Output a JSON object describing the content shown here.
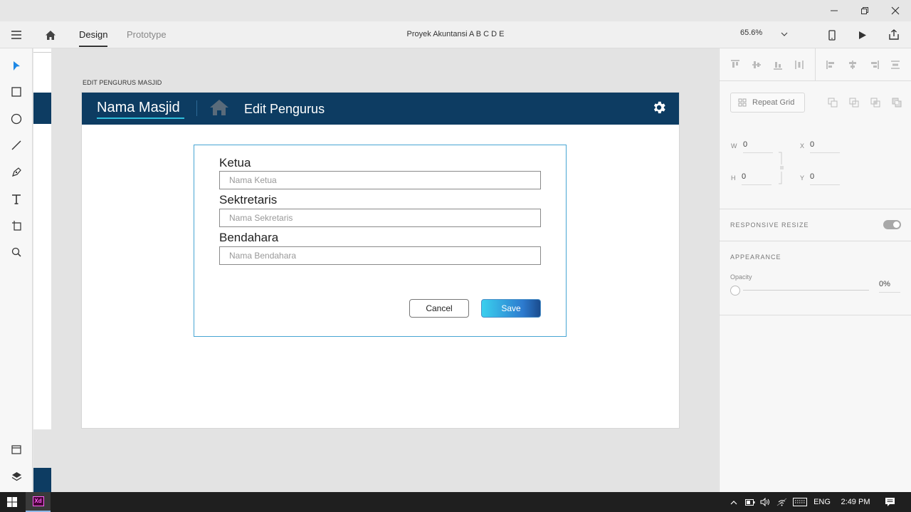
{
  "window": {
    "minimize_label": "—",
    "restore_label": "⧉",
    "close_label": "✕"
  },
  "appbar": {
    "tabs": [
      {
        "label": "Design",
        "active": true
      },
      {
        "label": "Prototype",
        "active": false
      }
    ],
    "document_title": "Proyek Akuntansi A B C D E",
    "zoom": "65.6%",
    "icons": [
      "hamburger-menu-icon",
      "home-icon",
      "mobile-preview-icon",
      "play-icon",
      "share-icon"
    ]
  },
  "toolbar": {
    "tools": [
      "select-tool-icon",
      "rectangle-tool-icon",
      "ellipse-tool-icon",
      "line-tool-icon",
      "pen-tool-icon",
      "text-tool-icon",
      "artboard-tool-icon",
      "zoom-tool-icon"
    ],
    "bottom": [
      "assets-icon",
      "layers-icon"
    ]
  },
  "canvas": {
    "artboard_label": "EDIT PENGURUS MASJID",
    "header": {
      "brand": "Nama Masjid",
      "page_title": "Edit Pengurus"
    },
    "form": {
      "fields": [
        {
          "label": "Ketua",
          "placeholder": "Nama Ketua"
        },
        {
          "label": "Sektretaris",
          "placeholder": "Nama Sekretaris"
        },
        {
          "label": "Bendahara",
          "placeholder": "Nama Bendahara"
        }
      ],
      "cancel_label": "Cancel",
      "save_label": "Save"
    },
    "colors": {
      "header_bg": "#0d3c62",
      "accent": "#2fbfdc",
      "form_border": "#47a5d3"
    }
  },
  "panel": {
    "repeat_grid": "Repeat Grid",
    "w_label": "W",
    "w_value": "0",
    "x_label": "X",
    "x_value": "0",
    "h_label": "H",
    "h_value": "0",
    "y_label": "Y",
    "y_value": "0",
    "responsive_resize": "RESPONSIVE RESIZE",
    "appearance": "APPEARANCE",
    "opacity_label": "Opacity",
    "opacity_value": "0%"
  },
  "taskbar": {
    "language": "ENG",
    "time": "2:49 PM",
    "app_badge": "Xd"
  }
}
